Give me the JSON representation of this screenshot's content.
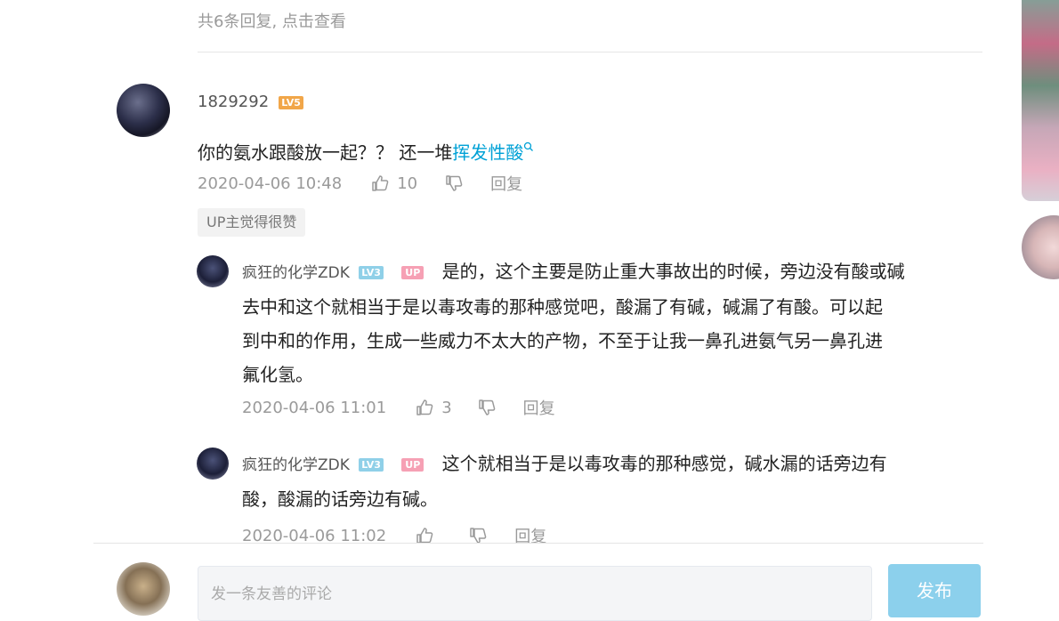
{
  "more_replies": "共6条回复, 点击查看",
  "comment": {
    "username": "1829292",
    "level_badge": "LV5",
    "text_before_link": "你的氨水跟酸放一起？？ 还一堆",
    "link_text": "挥发性酸",
    "link_icon": "search-icon",
    "timestamp": "2020-04-06 10:48",
    "like_count": "10",
    "reply_label": "回复",
    "up_badge": "UP主觉得很赞"
  },
  "replies": [
    {
      "username": "疯狂的化学ZDK",
      "level_badge": "LV3",
      "up_badge": "UP",
      "lines": [
        "是的，这个主要是防止重大事故出的时候，旁边没有酸或碱",
        "去中和这个就相当于是以毒攻毒的那种感觉吧，酸漏了有碱，碱漏了有酸。可以起",
        "到中和的作用，生成一些威力不太大的产物，不至于让我一鼻孔进氨气另一鼻孔进",
        "氟化氢。"
      ],
      "timestamp": "2020-04-06 11:01",
      "like_count": "3",
      "reply_label": "回复"
    },
    {
      "username": "疯狂的化学ZDK",
      "level_badge": "LV3",
      "up_badge": "UP",
      "lines": [
        "这个就相当于是以毒攻毒的那种感觉，碱水漏的话旁边有",
        "酸，酸漏的话旁边有碱。"
      ],
      "timestamp": "2020-04-06 11:02",
      "like_count": "",
      "reply_label": "回复"
    }
  ],
  "composer": {
    "placeholder": "发一条友善的评论",
    "send_label": "发布"
  },
  "colors": {
    "link": "#00a1d6",
    "level5": "#f1a649",
    "level3": "#8fd0e8",
    "up_badge": "#f6a0b4",
    "send_button": "#8cd0ec"
  }
}
